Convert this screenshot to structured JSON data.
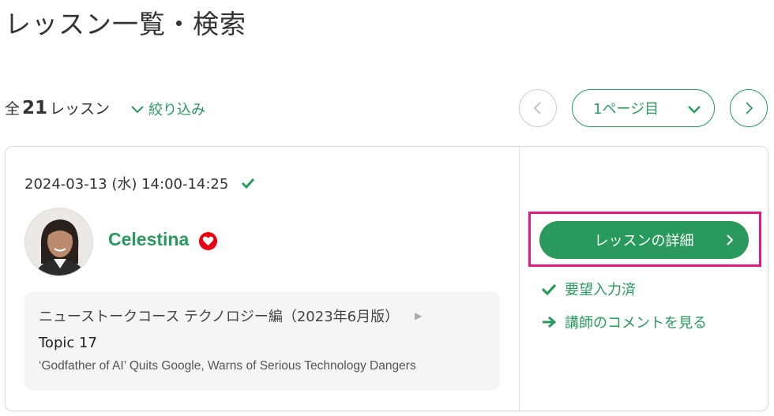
{
  "page": {
    "title": "レッスン一覧・検索"
  },
  "summary": {
    "prefix": "全",
    "count": "21",
    "suffix": "レッスン"
  },
  "filter": {
    "label": "絞り込み"
  },
  "pager": {
    "current": "1ページ目"
  },
  "lesson": {
    "datetime": "2024-03-13 (水) 14:00-14:25",
    "teacher": {
      "name": "Celestina"
    },
    "course": {
      "title": "ニューストークコース テクノロジー編（2023年6月版）",
      "topic": "Topic 17",
      "subtitle": "‘Godfather of AI’ Quits Google, Warns of Serious Technology Dangers"
    },
    "detail_button": "レッスンの詳細",
    "request_status": "要望入力済",
    "teacher_comment_link": "講師のコメントを見る"
  },
  "colors": {
    "accent": "#2a9a5c",
    "highlight": "#e8197e",
    "favorite": "#e60012"
  },
  "icons": [
    "check-icon",
    "chevron-down-icon",
    "chevron-left-icon",
    "chevron-right-icon",
    "heart-icon",
    "arrow-right-icon"
  ]
}
